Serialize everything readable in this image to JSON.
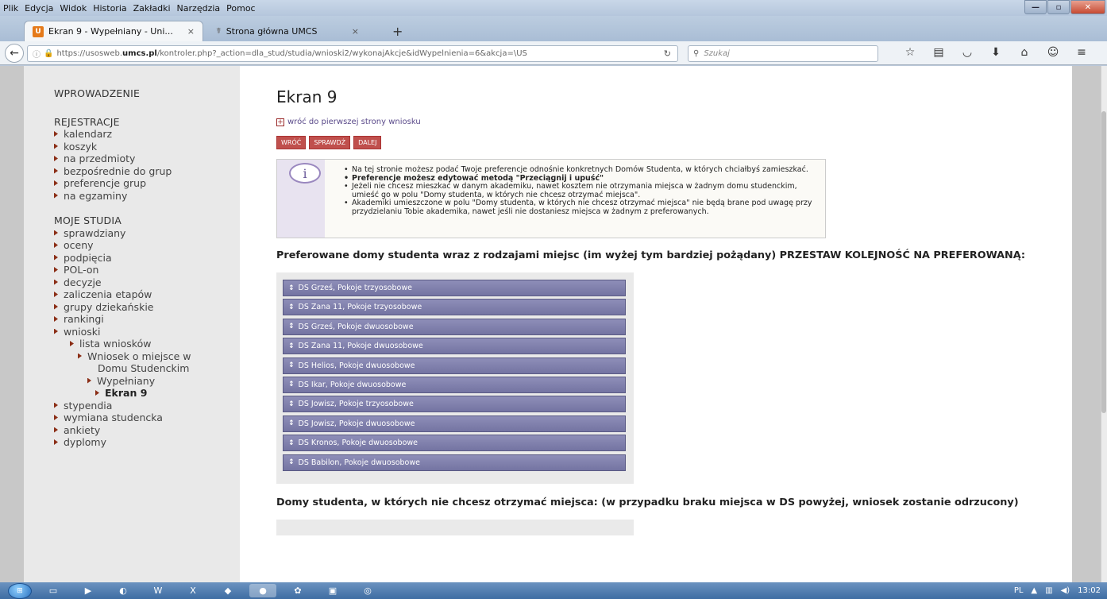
{
  "menu": [
    "Plik",
    "Edycja",
    "Widok",
    "Historia",
    "Zakładki",
    "Narzędzia",
    "Pomoc"
  ],
  "tabs": [
    {
      "label": "Ekran 9 - Wypełniany - Uni...",
      "close": "×"
    },
    {
      "label": "Strona główna UMCS",
      "close": "×"
    }
  ],
  "newtab": "+",
  "address": {
    "prefix": "https://usosweb.",
    "domain": "umcs.pl",
    "path": "/kontroler.php?_action=dla_stud/studia/wnioski2/wykonajAkcje&idWypelnienia=6&akcja=\\US"
  },
  "search": {
    "placeholder": "Szukaj"
  },
  "sidebar": {
    "intro": "WPROWADZENIE",
    "sections": [
      {
        "title": "REJESTRACJE",
        "items": [
          "kalendarz",
          "koszyk",
          "na przedmioty",
          "bezpośrednie do grup",
          "preferencje grup",
          "na egzaminy"
        ]
      },
      {
        "title": "MOJE STUDIA",
        "items": [
          "sprawdziany",
          "oceny",
          "podpięcia",
          "POL-on",
          "decyzje",
          "zaliczenia etapów",
          "grupy dziekańskie",
          "rankingi",
          "wnioski"
        ]
      }
    ],
    "sub_l2": "lista wniosków",
    "sub_l3a": "Wniosek o miejsce w",
    "sub_l3b": "Domu Studenckim",
    "sub_l4": "Wypełniany",
    "sub_l5": "Ekran 9",
    "after": [
      "stypendia",
      "wymiana studencka",
      "ankiety",
      "dyplomy"
    ]
  },
  "main": {
    "title": "Ekran 9",
    "backlink": "wróć do pierwszej strony wniosku",
    "buttons": [
      "WRÓĆ",
      "SPRAWDŹ",
      "DALEJ"
    ],
    "info": [
      "Na tej stronie możesz podać Twoje preferencje odnośnie konkretnych Domów Studenta, w których chciałbyś zamieszkać.",
      "Preferencje możesz edytować metodą \"Przeciągnij i upuść\"",
      "Jeżeli nie chcesz mieszkać w danym akademiku, nawet kosztem nie otrzymania miejsca w żadnym domu studenckim, umieść go w polu \"Domy studenta, w których nie chcesz otrzymać miejsca\".",
      "Akademiki umieszczone w polu \"Domy studenta, w których nie chcesz otrzymać miejsca\" nie będą brane pod uwagę przy przydzielaniu Tobie akademika, nawet jeśli nie dostaniesz miejsca w żadnym z preferowanych."
    ],
    "pref_title": "Preferowane domy studenta wraz z rodzajami miejsc (im wyżej tym bardziej pożądany) PRZESTAW KOLEJNOŚĆ NA PREFEROWANĄ:",
    "preferences": [
      "DS Grześ, Pokoje trzyosobowe",
      "DS Zana 11, Pokoje trzyosobowe",
      "DS Grześ, Pokoje dwuosobowe",
      "DS Zana 11, Pokoje dwuosobowe",
      "DS Helios, Pokoje dwuosobowe",
      "DS Ikar, Pokoje dwuosobowe",
      "DS Jowisz, Pokoje trzyosobowe",
      "DS Jowisz, Pokoje dwuosobowe",
      "DS Kronos, Pokoje dwuosobowe",
      "DS Babilon, Pokoje dwuosobowe"
    ],
    "notpref_title": "Domy studenta, w których nie chcesz otrzymać miejsca: (w przypadku braku miejsca w DS powyżej, wniosek zostanie odrzucony)"
  },
  "tray": {
    "lang": "PL",
    "time": "13:02"
  }
}
